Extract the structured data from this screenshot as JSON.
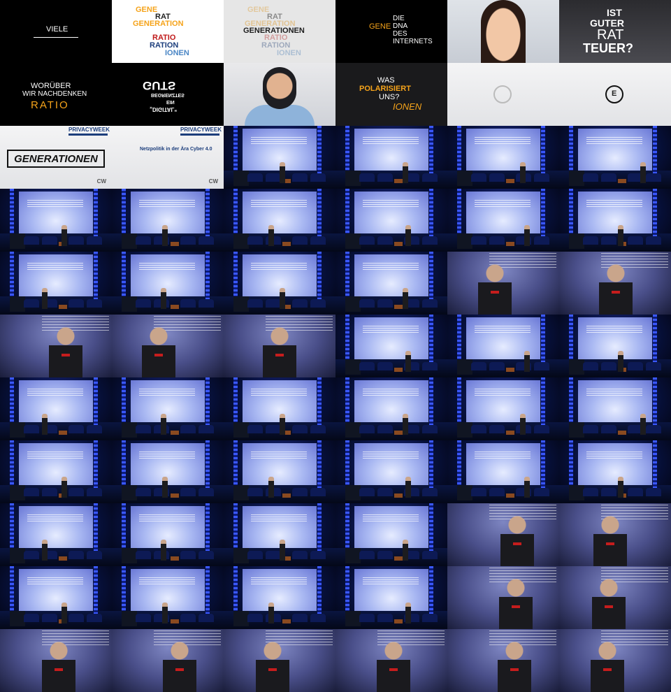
{
  "slides": {
    "viele": "VIELE",
    "w1": [
      "GENE",
      "RAT",
      "GENERATION",
      "RATIO",
      "RATION",
      "IONEN"
    ],
    "w2": [
      "GENE",
      "RAT",
      "GENERATION",
      "GENERATIONEN",
      "RATIO",
      "RATION",
      "IONEN"
    ],
    "dna": [
      "GENE",
      "DIE",
      "DNA",
      "DES",
      "INTERNETS"
    ],
    "rat": [
      "IST",
      "GUTER",
      "RAT",
      "TEUER?"
    ],
    "worueber": [
      "WORÜBER",
      "WIR NACHDENKEN",
      "RATIO"
    ],
    "digital": [
      "GUTS",
      "BEGRENZTES",
      "EIN",
      "„DIGITAL“"
    ],
    "polar": [
      "WAS",
      "POLARISIERT",
      "UNS?",
      "IONEN"
    ],
    "logo_letter": "E",
    "privacyweek": "PRIVACYWEEK",
    "generationen": "GENERATIONEN",
    "netzpolitik": "Netzpolitik in der Ära Cyber 4.0",
    "cw": "CW"
  },
  "colors": {
    "orange": "#f5a31a",
    "navy": "#1c3e7c",
    "light_blue": "#4a86c5",
    "red": "#c01a1a",
    "stage_blue": "#1c2a8e"
  },
  "grid": {
    "columns": 6,
    "rows": 11
  }
}
